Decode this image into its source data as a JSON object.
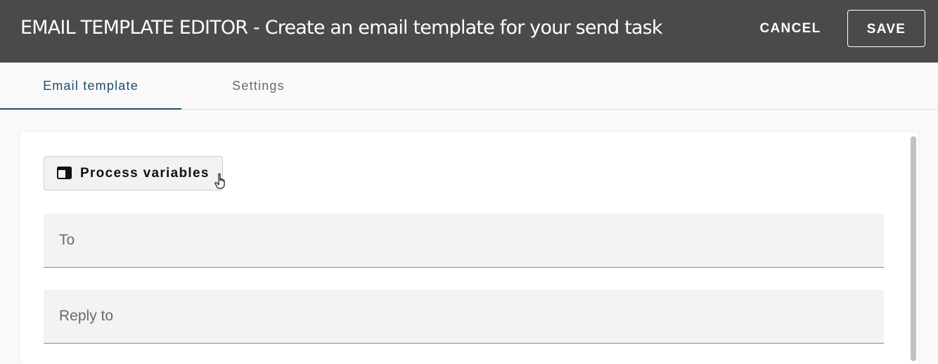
{
  "header": {
    "title": "EMAIL TEMPLATE EDITOR - Create an email template for your send task",
    "cancel_label": "CANCEL",
    "save_label": "SAVE",
    "background_color": "#4a4a4a"
  },
  "tabs": [
    {
      "label": "Email template",
      "active": true
    },
    {
      "label": "Settings",
      "active": false
    }
  ],
  "accent_color": "#1b4f6e",
  "toolbar": {
    "process_variables_label": "Process variables",
    "process_variables_icon": "table-panel-icon"
  },
  "form": {
    "to_placeholder": "To",
    "reply_to_placeholder": "Reply to"
  }
}
